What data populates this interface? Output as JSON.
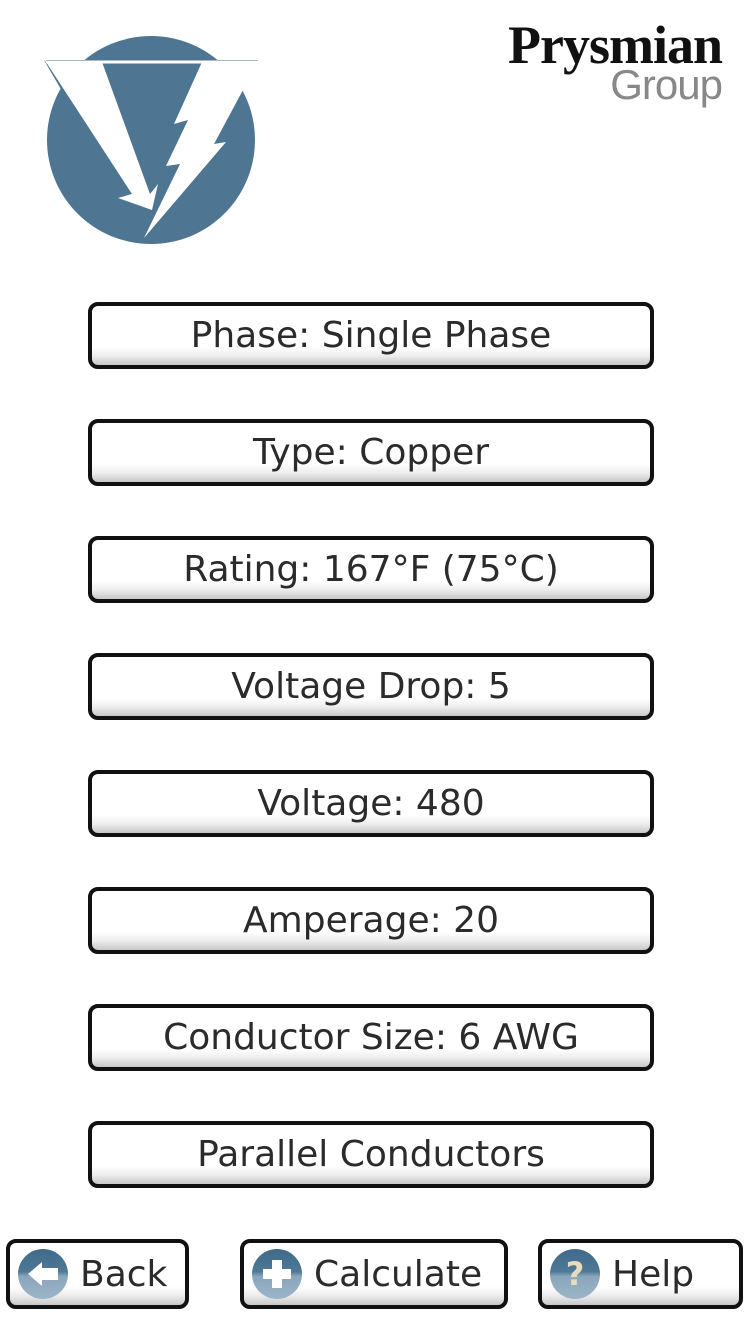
{
  "branding": {
    "company_line1": "Prysmian",
    "company_line2": "Group"
  },
  "colors": {
    "logo_blue": "#4e7692",
    "border": "#111111",
    "text": "#2b2b2b"
  },
  "options": [
    {
      "label": "Phase: Single Phase"
    },
    {
      "label": "Type: Copper"
    },
    {
      "label": "Rating: 167°F (75°C)"
    },
    {
      "label": "Voltage Drop: 5"
    },
    {
      "label": "Voltage: 480"
    },
    {
      "label": "Amperage: 20"
    },
    {
      "label": "Conductor Size: 6 AWG"
    },
    {
      "label": "Parallel Conductors"
    }
  ],
  "footer": {
    "back": {
      "label": "Back",
      "icon": "arrow-left-icon"
    },
    "calculate": {
      "label": "Calculate",
      "icon": "plus-icon"
    },
    "help": {
      "label": "Help",
      "icon": "question-icon",
      "glyph": "?"
    }
  }
}
